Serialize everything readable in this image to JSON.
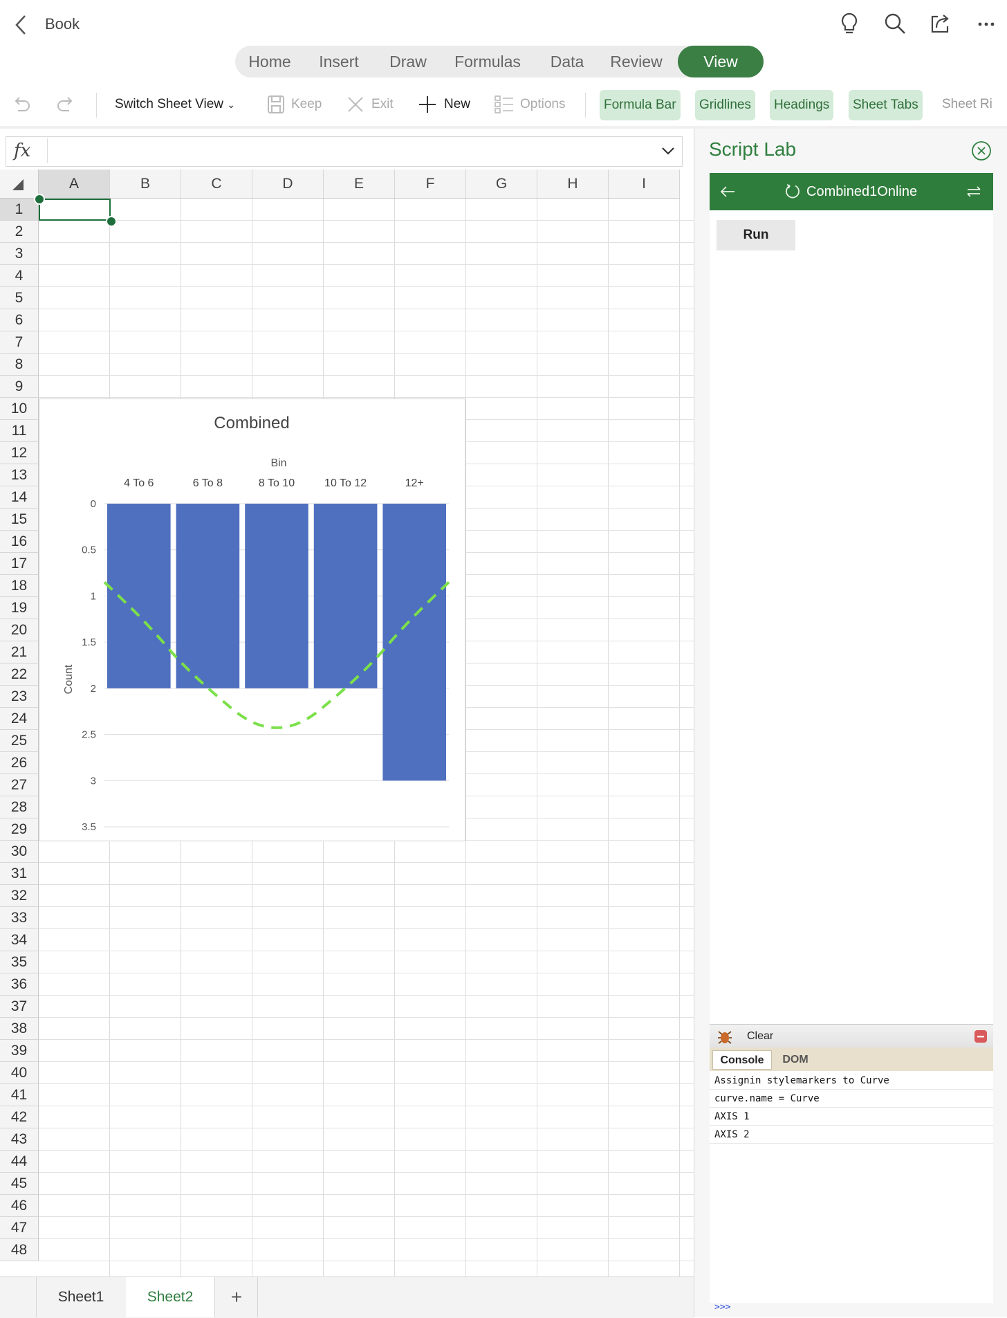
{
  "app": {
    "title": "Book",
    "ribbon_tabs": [
      {
        "label": "Home"
      },
      {
        "label": "Insert"
      },
      {
        "label": "Draw"
      },
      {
        "label": "Formulas"
      },
      {
        "label": "Data"
      },
      {
        "label": "Review"
      },
      {
        "label": "View",
        "active": true
      }
    ],
    "toolbar": {
      "switch_sheet_view": "Switch Sheet View",
      "keep": "Keep",
      "exit": "Exit",
      "new": "New",
      "options": "Options",
      "formula_bar": "Formula Bar",
      "gridlines": "Gridlines",
      "headings": "Headings",
      "sheet_tabs": "Sheet Tabs",
      "sheet_right": "Sheet Ri"
    },
    "formula_bar": {
      "label": "fx",
      "value": ""
    },
    "accent": "#2f7d3c"
  },
  "grid": {
    "columns": [
      "A",
      "B",
      "C",
      "D",
      "E",
      "F",
      "G",
      "H",
      "I"
    ],
    "rows": [
      "1",
      "2",
      "3",
      "4",
      "5",
      "6",
      "7",
      "8",
      "9",
      "10",
      "11",
      "12",
      "13",
      "14",
      "15",
      "16",
      "17",
      "18",
      "19",
      "20",
      "21",
      "22",
      "23",
      "24",
      "25",
      "26",
      "27",
      "28",
      "29",
      "30",
      "31",
      "32",
      "33",
      "34",
      "35",
      "36",
      "37",
      "38",
      "39",
      "40",
      "41",
      "42",
      "43",
      "44",
      "45",
      "46",
      "47",
      "48"
    ],
    "selected_cell": "A1"
  },
  "chart_data": {
    "type": "bar",
    "title": "Combined",
    "xlabel": "Bin",
    "ylabel": "Count",
    "categories": [
      "4 To 6",
      "6 To 8",
      "8 To 10",
      "10 To 12",
      "12+"
    ],
    "values": [
      2,
      2,
      2,
      2,
      3
    ],
    "y_reversed": true,
    "x_axis_position": "top",
    "ylim": [
      0,
      3.5
    ],
    "yticks": [
      "0",
      "0.5",
      "1",
      "1.5",
      "2",
      "2.5",
      "3",
      "3.5"
    ],
    "bar_color": "#4f6fbf",
    "overlay": {
      "type": "line",
      "style": "dashed",
      "color": "#7be04a",
      "curve": [
        [
          0,
          0.85
        ],
        [
          0.5,
          1.3
        ],
        [
          1,
          1.85
        ],
        [
          2,
          2.62
        ],
        [
          3,
          1.85
        ],
        [
          3.5,
          1.3
        ],
        [
          4,
          0.85
        ]
      ]
    },
    "grid": true,
    "legend": "none"
  },
  "sheets": {
    "tabs": [
      {
        "label": "Sheet1"
      },
      {
        "label": "Sheet2",
        "active": true
      }
    ],
    "add_label": "+"
  },
  "pane": {
    "title": "Script Lab",
    "snippet_name": "Combined1Online",
    "run_label": "Run",
    "console": {
      "clear_label": "Clear",
      "tabs": [
        "Console",
        "DOM"
      ],
      "lines": [
        "Assignin stylemarkers to Curve",
        "curve.name = Curve",
        "AXIS 1",
        "AXIS 2"
      ],
      "prompt": ">>>"
    }
  }
}
